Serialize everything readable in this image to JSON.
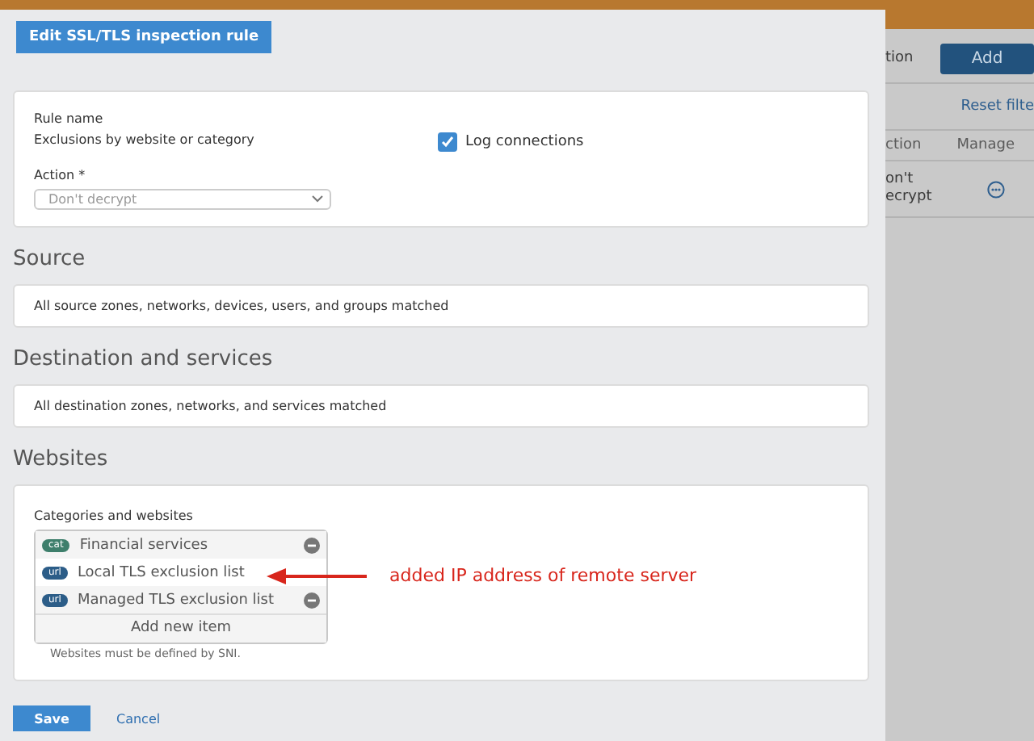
{
  "background_page": {
    "toolbar_label": "tion",
    "add_button": "Add",
    "reset_filter": "Reset filte",
    "columns": [
      "ction",
      "Manage"
    ],
    "row": {
      "action": [
        "on't",
        "ecrypt"
      ]
    }
  },
  "dialog": {
    "title": "Edit SSL/TLS inspection rule",
    "rule_name": {
      "label": "Rule name",
      "value": "Exclusions by website or category"
    },
    "log_connections": {
      "label": "Log connections",
      "checked": true
    },
    "action": {
      "label": "Action *",
      "placeholder": "Don't decrypt"
    },
    "sections": [
      {
        "heading": "Source",
        "text": "All source zones, networks, devices, users, and groups matched"
      },
      {
        "heading": "Destination and services",
        "text": "All destination zones, networks, and services matched"
      }
    ],
    "websites": {
      "heading": "Websites",
      "label": "Categories and websites",
      "items": [
        {
          "tag": "cat",
          "color": "#3e7f6c",
          "name": "Financial services",
          "removable": true
        },
        {
          "tag": "url",
          "color": "#2c5d88",
          "name": "Local TLS exclusion list",
          "removable": false
        },
        {
          "tag": "url",
          "color": "#2c5d88",
          "name": "Managed TLS exclusion list",
          "removable": true
        }
      ],
      "add_item": "Add new item",
      "hint": "Websites must be defined by SNI."
    },
    "buttons": {
      "save": "Save",
      "cancel": "Cancel"
    }
  },
  "annotation": {
    "text": "added IP address of remote server"
  }
}
